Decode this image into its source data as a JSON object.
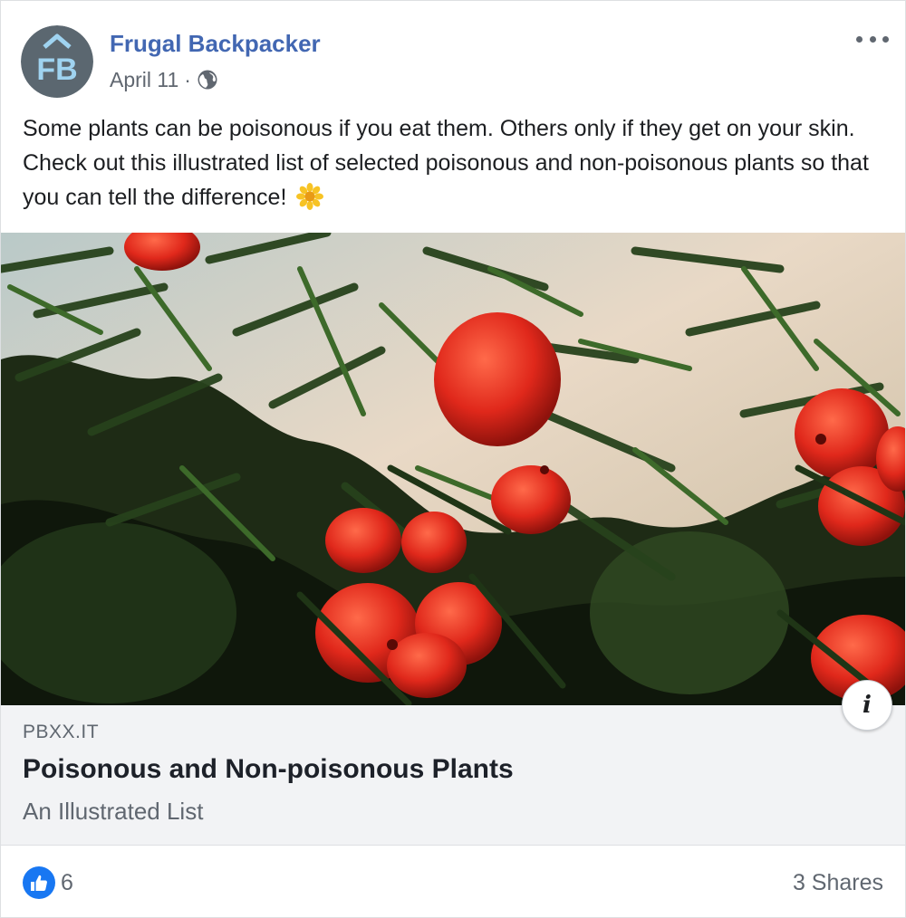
{
  "post": {
    "page_name": "Frugal Backpacker",
    "date": "April 11",
    "separator": "·",
    "privacy_icon": "globe-icon",
    "more_icon": "more-options-icon",
    "avatar_letters": "FB",
    "avatar_color": "#5b6770",
    "text": "Some plants can be poisonous if you eat them. Others only if they get on your skin. Check out this illustrated list of selected poisonous and non-poisonous plants so that you can tell the difference!",
    "text_emoji": "blossom-emoji"
  },
  "link": {
    "image_description_icon": "info-icon",
    "info_label": "i",
    "domain": "PBXX.IT",
    "title": "Poisonous and Non-poisonous Plants",
    "description": "An Illustrated List"
  },
  "footer": {
    "reaction_icon": "like-icon",
    "like_count": "6",
    "shares": "3 Shares"
  },
  "colors": {
    "accent": "#4267b2",
    "like_blue": "#1877f2",
    "link_bg": "#f2f3f5",
    "secondary_text": "#606770"
  }
}
